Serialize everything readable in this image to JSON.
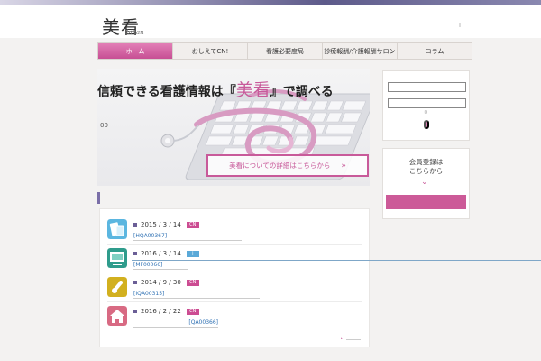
{
  "header": {
    "logo_text": "美看",
    "logo_sub": "bikan"
  },
  "nav": {
    "items": [
      {
        "label": "ホーム",
        "active": true
      },
      {
        "label": "おしえてCN!",
        "active": false
      },
      {
        "label": "看護必要度局",
        "active": false
      },
      {
        "label": "診療報酬/介護報酬サロン",
        "active": false
      },
      {
        "label": "コラム",
        "active": false
      }
    ]
  },
  "hero": {
    "title_before": "信頼できる看護情報は『",
    "title_brand": "美看",
    "title_after": "』で調べる",
    "counter": "00",
    "detail_button": "美看についての詳細はこちらから",
    "detail_arrow": "»"
  },
  "login": {
    "remember": "ㅁ"
  },
  "member": {
    "line1": "会員登録は",
    "line2": "こちらから",
    "chevron": "⌄"
  },
  "news": {
    "items": [
      {
        "icon": "tablet-icon",
        "icon_color": "#5bb6e0",
        "date": "2015 / 3 / 14",
        "badge": "CN",
        "badge_color": "#cc4c92",
        "code": "[HQA00367]"
      },
      {
        "icon": "monitor-icon",
        "icon_color": "#2f9c8c",
        "date": "2016 / 3 / 14",
        "badge": "i",
        "badge_color": "#5aa9d8",
        "code": "[MF00066]"
      },
      {
        "icon": "syringe-icon",
        "icon_color": "#d2b01f",
        "date": "2014 / 9 / 30",
        "badge": "CN",
        "badge_color": "#cc4c92",
        "code": "[IQA00315]"
      },
      {
        "icon": "house-icon",
        "icon_color": "#d86a83",
        "date": "2016 / 2 / 22",
        "badge": "CN",
        "badge_color": "#cc4c92",
        "code": "[QA00366]"
      }
    ],
    "more_arrow": "▸"
  },
  "colors": {
    "accent": "#c85a9a",
    "nav_active": "#d96aa9",
    "link": "#2e70b3"
  }
}
